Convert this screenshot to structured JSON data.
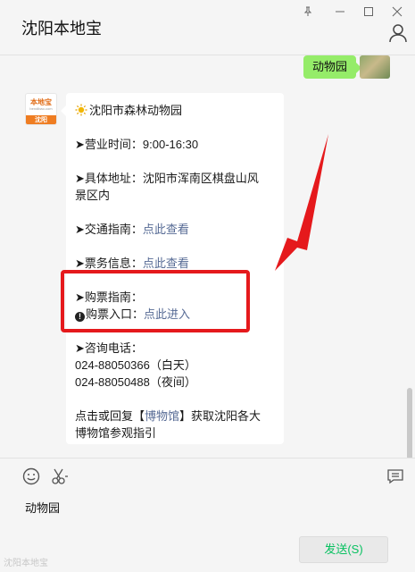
{
  "window": {
    "title": "沈阳本地宝",
    "controls": {
      "pin": "⊥",
      "minimize": "—",
      "maximize": "□",
      "close": "✕"
    }
  },
  "outgoing_message": {
    "text": "动物园"
  },
  "bot": {
    "avatar": {
      "brand": "本地宝",
      "site": "bendibao.com",
      "city": "沈阳"
    }
  },
  "reply": {
    "title": "沈阳市森林动物园",
    "hours": "➤营业时间：9:00-16:30",
    "address_line1": "➤具体地址：沈阳市浑南区棋盘山风",
    "address_line2": "景区内",
    "traffic_label": "➤交通指南：",
    "traffic_link": "点此查看",
    "ticket_info_label": "➤票务信息：",
    "ticket_info_link": "点此查看",
    "buy_guide": "➤购票指南：",
    "buy_entry_label": "购票入口：",
    "buy_entry_link": "点此进入",
    "consult_label": "➤咨询电话：",
    "phone_day": "024-88050366（白天）",
    "phone_night": "024-88050488（夜间）",
    "footer_prefix": "点击或回复【",
    "footer_link": "博物馆",
    "footer_suffix": "】获取沈阳各大",
    "footer_line2": "博物馆参观指引"
  },
  "input": {
    "draft": "动物园",
    "send_label": "发送(S)"
  },
  "watermark": "沈阳本地宝",
  "colors": {
    "accent_red": "#e5191c",
    "bubble_green": "#95ec69",
    "link": "#576b95",
    "send_text": "#07c160"
  }
}
